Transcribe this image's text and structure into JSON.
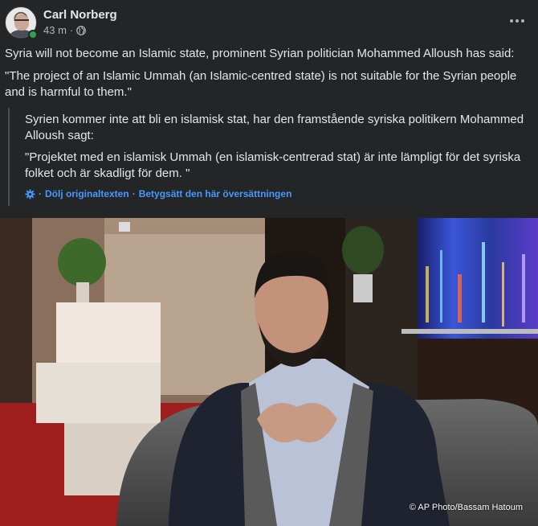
{
  "post": {
    "author_name": "Carl Norberg",
    "time": "43 m",
    "meta_separator": "·",
    "privacy_icon": "globe-icon",
    "more_icon": "more-options-icon",
    "paragraph_1": "Syria will not become an Islamic state, prominent Syrian politician Mohammed Alloush has said:",
    "paragraph_2": "\"The project of an Islamic Ummah (an Islamic-centred state) is not suitable for the Syrian people and is harmful to them.\"",
    "translation": {
      "text_1": "Syrien kommer inte att bli en islamisk stat, har den framstående syriska politikern Mohammed Alloush sagt:",
      "text_2": "\"Projektet med en islamisk Ummah (en islamisk-centrerad stat) är inte lämpligt för det syriska folket och är skadligt för dem. \"",
      "settings_icon": "gear-icon",
      "separator": "·",
      "hide_original_label": "Dölj originaltexten",
      "rate_translation_label": "Betygsätt den här översättningen"
    },
    "photo": {
      "credit": "© AP Photo/Bassam Hatoum"
    }
  },
  "colors": {
    "background": "#242526",
    "text_primary": "#e4e6eb",
    "text_secondary": "#b0b3b8",
    "link": "#4599ff",
    "online": "#31a24c"
  }
}
